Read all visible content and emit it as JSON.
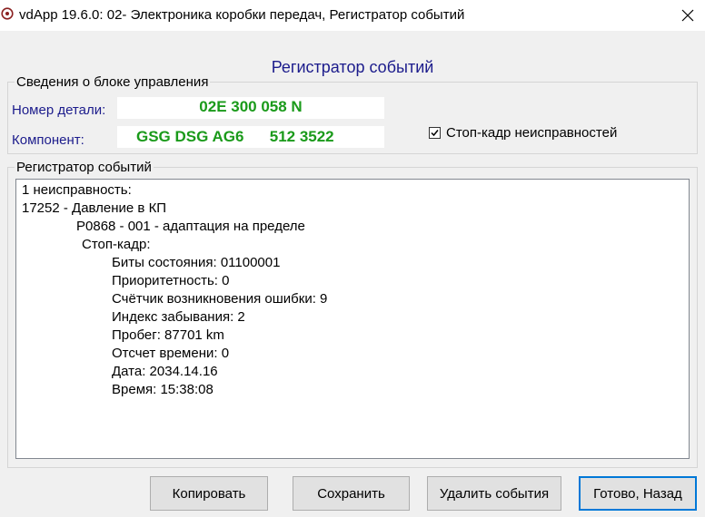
{
  "window": {
    "title": "vdApp 19.6.0: 02- Электроника коробки передач,  Регистратор событий",
    "icon": "vdapp-logo-icon",
    "close_icon": "close-icon"
  },
  "heading": "Регистратор событий",
  "control_unit_info": {
    "legend": "Сведения о блоке управления",
    "part_number_label": "Номер детали:",
    "part_number_value": "02E 300 058 N",
    "component_label": "Компонент:",
    "component_value": "GSG DSG AG6      512 3522",
    "freeze_frame_checkbox": {
      "label": "Стоп-кадр неисправностей",
      "checked": true
    }
  },
  "event_log": {
    "legend": "Регистратор событий",
    "lines": [
      "1 неисправность:",
      "17252 - Давление в КП",
      "P0868 - 001 - адаптация на пределе",
      "Стоп-кадр:",
      "Биты состояния: 01100001",
      "Приоритетность: 0",
      "Счётчик возникновения ошибки: 9",
      "Индекс забывания: 2",
      "Пробег: 87701 km",
      "Отсчет времени: 0",
      "Дата: 2034.14.16",
      "Время: 15:38:08"
    ]
  },
  "buttons": {
    "copy": "Копировать",
    "save": "Сохранить",
    "delete_events": "Удалить события",
    "done_back": "Готово, Назад"
  },
  "colors": {
    "label_blue": "#1c1c8c",
    "value_green": "#1a9a1a",
    "default_button_border": "#0078d7"
  }
}
